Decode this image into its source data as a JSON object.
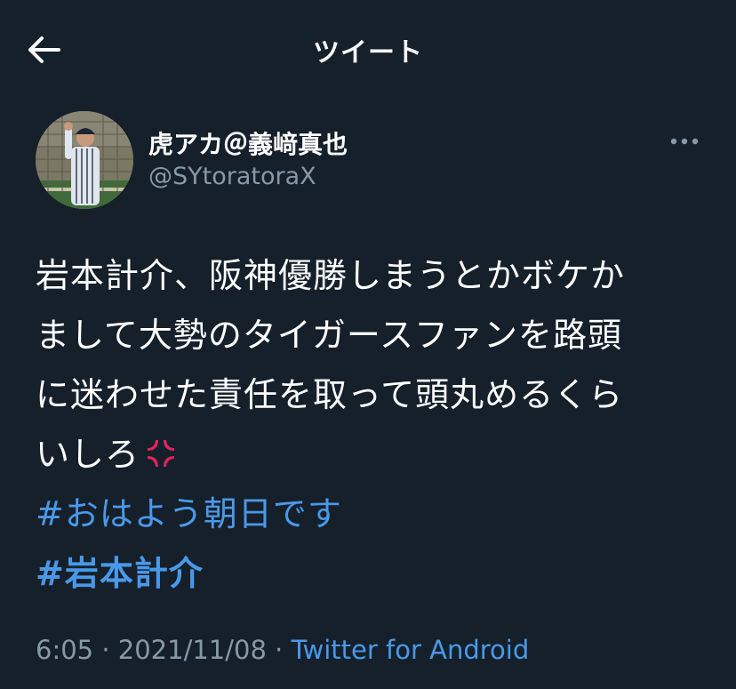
{
  "header": {
    "title": "ツイート",
    "back_icon": "arrow-left-icon"
  },
  "author": {
    "display_name": "虎アカ＠義﨑真也",
    "handle": "@SYtoratoraX",
    "avatar_icon": "profile-photo"
  },
  "more_icon": "more-dots-icon",
  "tweet": {
    "lines": [
      "岩本計介、阪神優勝しまうとかボケか",
      "まして大勢のタイガースファンを路頭",
      "に迷わせた責任を取って頭丸めるくら",
      "いしろ"
    ],
    "emoji": "anger-symbol-icon",
    "hashtags": [
      "#おはよう朝日です",
      "#岩本計介"
    ]
  },
  "meta": {
    "time": "6:05",
    "separator": "·",
    "date": "2021/11/08",
    "source": "Twitter for Android"
  },
  "colors": {
    "background": "#15202b",
    "text": "#ffffff",
    "secondary": "#8899a6",
    "link": "#4a99e9",
    "anger": "#e0245e"
  }
}
